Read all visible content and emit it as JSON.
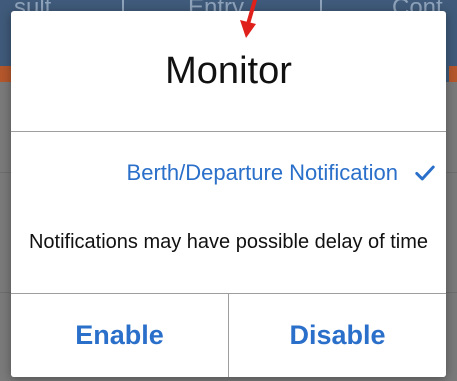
{
  "background": {
    "tabs": [
      "sult",
      "Entry",
      "Cont"
    ]
  },
  "dialog": {
    "title": "Monitor",
    "option": {
      "label": "Berth/Departure Notification",
      "checked": true,
      "icon": "check-icon"
    },
    "notice": "Notifications may have possible delay of time",
    "buttons": {
      "enable": "Enable",
      "disable": "Disable"
    }
  },
  "colors": {
    "accent": "#2a6fc9",
    "annotation_arrow": "#e0201b",
    "background_header": "#3f5a7a"
  }
}
